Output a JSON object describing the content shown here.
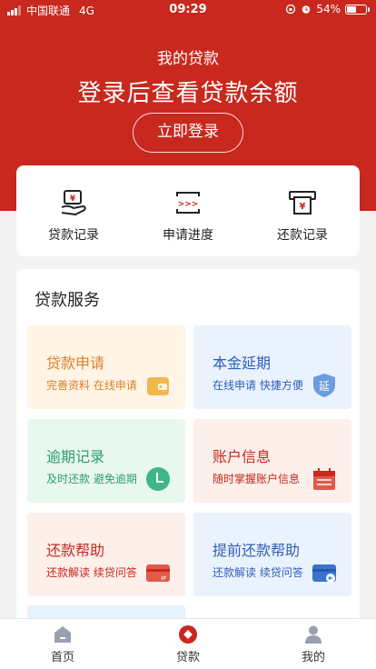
{
  "status_bar": {
    "carrier": "中国联通",
    "network": "4G",
    "time": "09:29",
    "battery": "54%",
    "battery_level": 0.54
  },
  "hero": {
    "title": "我的贷款",
    "subtitle": "登录后查看贷款余额",
    "login_label": "立即登录",
    "bg_color": "#c8281d"
  },
  "quick_actions": [
    {
      "label": "贷款记录",
      "icon": "loan-record-icon"
    },
    {
      "label": "申请进度",
      "icon": "progress-icon"
    },
    {
      "label": "还款记录",
      "icon": "repayment-record-icon"
    }
  ],
  "services": {
    "title": "贷款服务",
    "items": [
      {
        "title": "贷款申请",
        "desc": "完善资料 在线申请",
        "icon": "wallet-icon",
        "title_color": "#d9822b",
        "bg": "#fff4e6"
      },
      {
        "title": "本金延期",
        "desc": "在线申请 快捷方便",
        "icon": "extend-shield-icon",
        "icon_text": "延",
        "title_color": "#2f5fb8",
        "bg": "#eaf2fd"
      },
      {
        "title": "逾期记录",
        "desc": "及时还款 避免逾期",
        "icon": "clock-icon",
        "title_color": "#2e9d6e",
        "bg": "#e8f8ef"
      },
      {
        "title": "账户信息",
        "desc": "随时掌握账户信息",
        "icon": "calendar-icon",
        "title_color": "#c8281d",
        "bg": "#fdefea"
      },
      {
        "title": "还款帮助",
        "desc": "还款解读 续贷问答",
        "icon": "card-icon",
        "title_color": "#c8281d",
        "bg": "#fdefea"
      },
      {
        "title": "提前还款帮助",
        "desc": "还款解读 续贷问答",
        "icon": "card-back-icon",
        "title_color": "#2f5fb8",
        "bg": "#eaf2fd"
      }
    ]
  },
  "tabbar": [
    {
      "label": "首页",
      "icon": "home-icon"
    },
    {
      "label": "贷款",
      "icon": "loan-icon",
      "active": true
    },
    {
      "label": "我的",
      "icon": "user-icon"
    }
  ]
}
